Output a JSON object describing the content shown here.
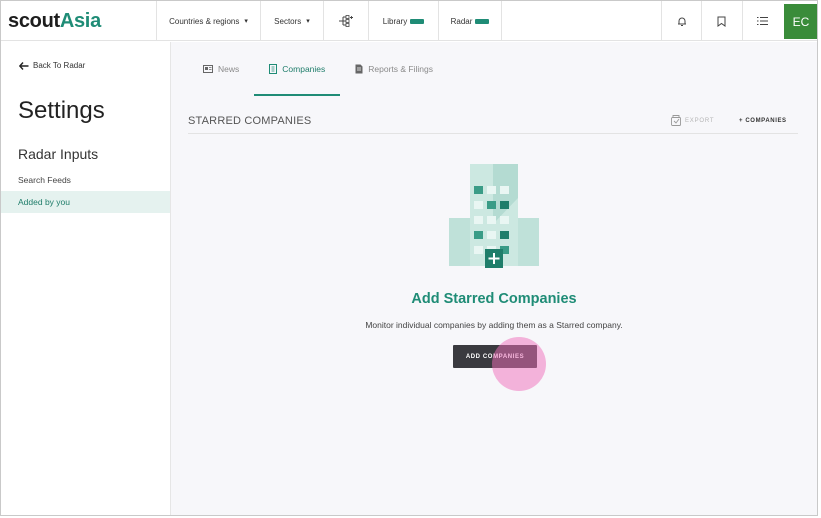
{
  "brand": {
    "part1": "scout",
    "part2": "Asia"
  },
  "nav": {
    "countries": "Countries & regions",
    "sectors": "Sectors",
    "library": "Library",
    "radar": "Radar"
  },
  "avatar_initials": "EC",
  "sidebar": {
    "back_label": "Back To Radar",
    "title": "Settings",
    "section": "Radar Inputs",
    "items": [
      {
        "label": "Search Feeds",
        "active": false
      },
      {
        "label": "Added by you",
        "active": true
      }
    ]
  },
  "tabs": [
    {
      "label": "News",
      "active": false
    },
    {
      "label": "Companies",
      "active": true
    },
    {
      "label": "Reports & Filings",
      "active": false
    }
  ],
  "section_header": {
    "title": "STARRED COMPANIES",
    "export_label": "EXPORT",
    "add_label": "+ COMPANIES"
  },
  "empty_state": {
    "title": "Add Starred Companies",
    "description": "Monitor individual companies by adding them as a Starred company.",
    "button_label": "ADD COMPANIES"
  },
  "colors": {
    "accent": "#1f8c76",
    "avatar_bg": "#3a8c3a",
    "active_item_bg": "#e5f2ef",
    "button_bg": "#3a3a3f",
    "click_indicator": "#f06eb9"
  }
}
